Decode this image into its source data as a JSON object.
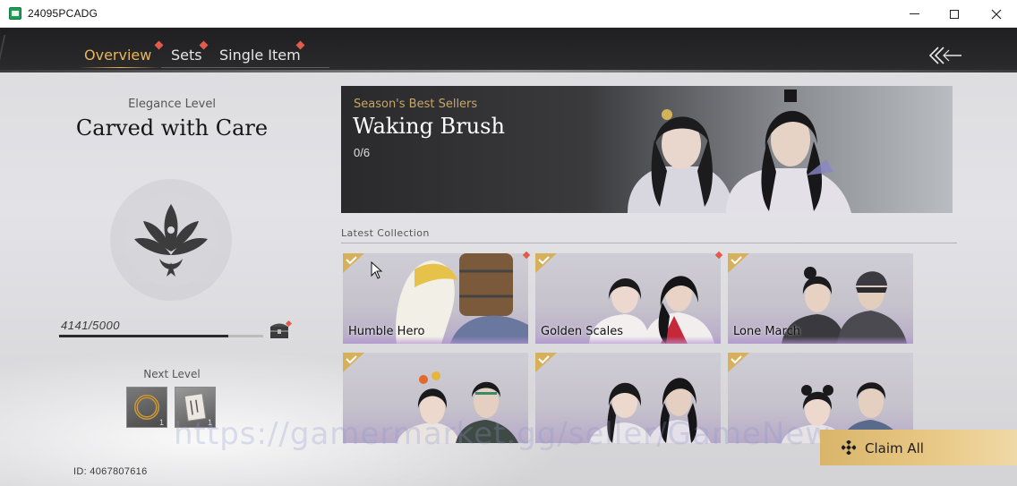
{
  "window": {
    "title": "24095PCADG"
  },
  "nav": {
    "tabs": [
      {
        "label": "Overview",
        "active": true
      },
      {
        "label": "Sets",
        "active": false
      },
      {
        "label": "Single Item",
        "active": false
      }
    ]
  },
  "elegance": {
    "caption": "Elegance Level",
    "title": "Carved with Care",
    "progress_text": "4141/5000",
    "progress_fraction": 0.828,
    "next_caption": "Next Level",
    "rewards": [
      {
        "icon": "bracelet-icon",
        "qty": "1"
      },
      {
        "icon": "scroll-icon",
        "qty": "1"
      }
    ],
    "player_id": "ID: 4067807616"
  },
  "banner": {
    "subtitle": "Season's Best Sellers",
    "title": "Waking Brush",
    "count": "0/6"
  },
  "latest": {
    "caption": "Latest Collection",
    "cards": [
      {
        "name": "Humble Hero",
        "checked": true
      },
      {
        "name": "Golden Scales",
        "checked": true
      },
      {
        "name": "Lone March",
        "checked": true
      },
      {
        "name": "",
        "checked": true
      },
      {
        "name": "",
        "checked": true
      },
      {
        "name": "",
        "checked": true
      }
    ]
  },
  "claim": {
    "label": "Claim All"
  },
  "watermark": "https://gamermarket.gg/seller/GameNew",
  "colors": {
    "accent_gold": "#e7b65a",
    "red_dot": "#e35a4b",
    "claim_bg": "#e0bf7c"
  }
}
